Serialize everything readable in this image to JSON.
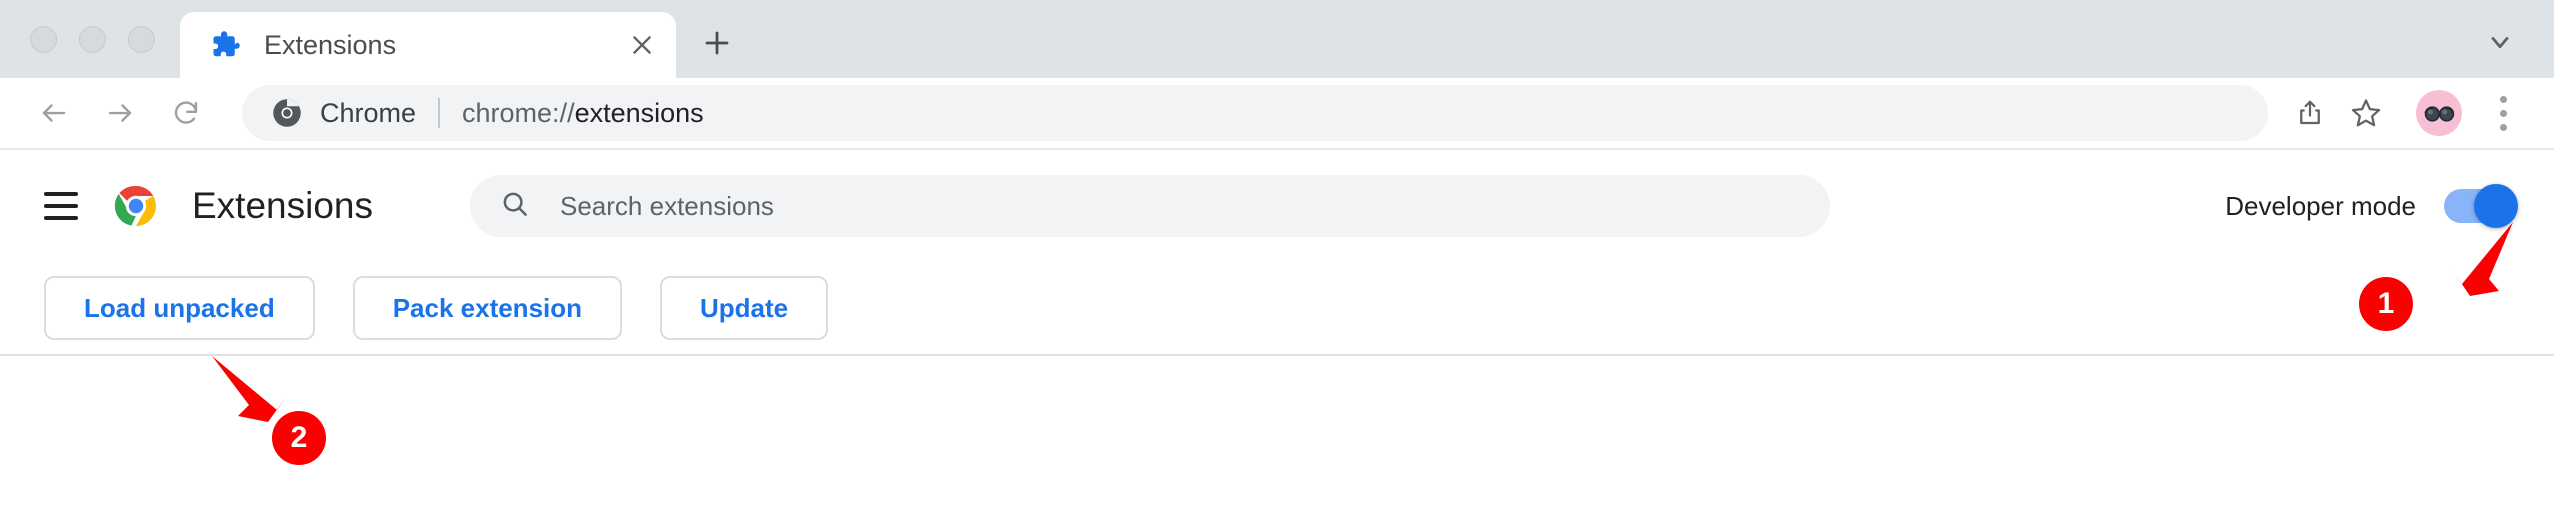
{
  "window": {
    "traffic_lights": [
      "close",
      "minimize",
      "maximize"
    ]
  },
  "tabstrip": {
    "tabs": [
      {
        "title": "Extensions",
        "favicon": "puzzle-piece-icon",
        "active": true,
        "close_label": "×"
      }
    ],
    "new_tab_label": "+",
    "tab_search_icon": "chevron-down-icon"
  },
  "toolbar": {
    "back_icon": "arrow-left-icon",
    "forward_icon": "arrow-right-icon",
    "reload_icon": "reload-icon",
    "omnibox": {
      "site_icon": "chrome-icon",
      "chip_label": "Chrome",
      "url_scheme": "chrome://",
      "url_host": "extensions"
    },
    "share_icon": "share-icon",
    "bookmark_icon": "star-icon",
    "avatar_icon": "sunglasses-avatar",
    "menu_icon": "kebab-menu-icon"
  },
  "extensions_page": {
    "menu_icon": "hamburger-menu-icon",
    "brand_icon": "chrome-logo-icon",
    "title": "Extensions",
    "search": {
      "icon": "search-icon",
      "placeholder": "Search extensions",
      "value": ""
    },
    "developer_mode": {
      "label": "Developer mode",
      "enabled": true
    },
    "buttons": [
      {
        "label": "Load unpacked"
      },
      {
        "label": "Pack extension"
      },
      {
        "label": "Update"
      }
    ]
  },
  "annotations": {
    "badges": [
      {
        "number": "1",
        "target": "developer-mode-toggle"
      },
      {
        "number": "2",
        "target": "load-unpacked-button"
      }
    ],
    "color": "#fa0000"
  },
  "colors": {
    "accent_blue": "#1a73e8",
    "toggle_track": "#8ab4f8",
    "tabstrip_bg": "#dee3e7",
    "omnibox_bg": "#f1f3f4",
    "annotation_red": "#fa0000",
    "avatar_bg": "#f7bfd4"
  }
}
